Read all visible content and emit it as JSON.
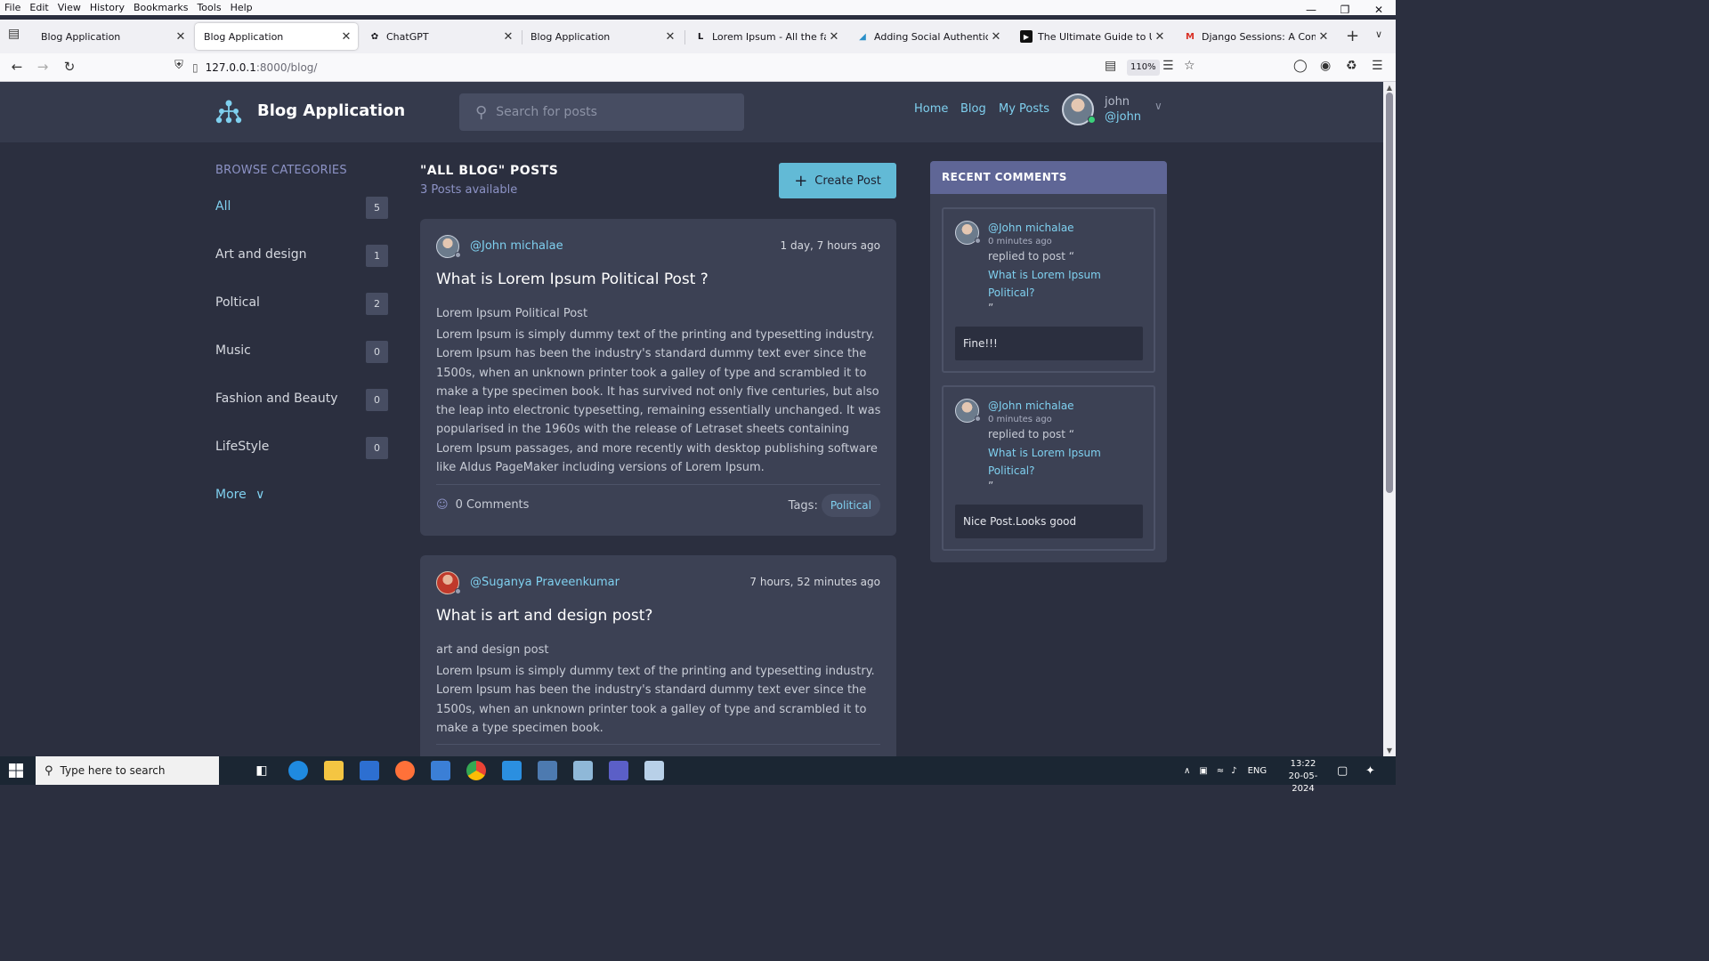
{
  "browser": {
    "menu": [
      "File",
      "Edit",
      "View",
      "History",
      "Bookmarks",
      "Tools",
      "Help"
    ],
    "tabs": [
      {
        "title": "Blog Application",
        "icon": "page-icon"
      },
      {
        "title": "Blog Application",
        "icon": "page-icon"
      },
      {
        "title": "ChatGPT",
        "icon": "chatgpt-icon"
      },
      {
        "title": "Blog Application",
        "icon": "page-icon"
      },
      {
        "title": "Lorem Ipsum - All the facts - Lip",
        "icon": "lipsum-icon"
      },
      {
        "title": "Adding Social Authentication to",
        "icon": "book-icon"
      },
      {
        "title": "The Ultimate Guide to Using Soc",
        "icon": "video-icon"
      },
      {
        "title": "Django Sessions: A Comprehen",
        "icon": "gmail-icon"
      }
    ],
    "url_host": "127.0.0.1",
    "url_path": ":8000/blog/",
    "zoom": "110%"
  },
  "header": {
    "brand": "Blog Application",
    "search_placeholder": "Search for posts",
    "nav": [
      "Home",
      "Blog",
      "My Posts"
    ],
    "user_name": "john",
    "user_handle": "@john"
  },
  "sidebar": {
    "title": "BROWSE CATEGORIES",
    "categories": [
      {
        "label": "All",
        "count": "5"
      },
      {
        "label": "Art and design",
        "count": "1"
      },
      {
        "label": "Poltical",
        "count": "2"
      },
      {
        "label": "Music",
        "count": "0"
      },
      {
        "label": "Fashion and Beauty",
        "count": "0"
      },
      {
        "label": "LifeStyle",
        "count": "0"
      }
    ],
    "more": "More"
  },
  "main": {
    "heading": "\"ALL BLOG\" POSTS",
    "subheading": "3 Posts available",
    "create_label": "Create Post",
    "posts": [
      {
        "author": "@John michalae",
        "time": "1 day, 7 hours ago",
        "title": "What is Lorem Ipsum Political Post ?",
        "subtitle": "Lorem Ipsum Political Post",
        "body": "Lorem Ipsum is simply dummy text of the printing and typesetting industry. Lorem Ipsum has been the industry's standard dummy text ever since the 1500s, when an unknown printer took a galley of type and scrambled it to make a type specimen book. It has survived not only five centuries, but also the leap into electronic typesetting, remaining essentially unchanged. It was popularised in the 1960s with the release of Letraset sheets containing Lorem Ipsum passages, and more recently with desktop publishing software like Aldus PageMaker including versions of Lorem Ipsum.",
        "comments": "0 Comments",
        "tags_label": "Tags:",
        "tag": "Political"
      },
      {
        "author": "@Suganya Praveenkumar",
        "time": "7 hours, 52 minutes ago",
        "title": "What is art and design post?",
        "subtitle": "art and design post",
        "body": "Lorem Ipsum is simply dummy text of the printing and typesetting industry. Lorem Ipsum has been the industry's standard dummy text ever since the 1500s, when an unknown printer took a galley of type and scrambled it to make a type specimen book."
      }
    ]
  },
  "recent_comments": {
    "title": "RECENT COMMENTS",
    "items": [
      {
        "author": "@John michalae",
        "time": "0 minutes ago",
        "replied": "replied to post “",
        "post": "What is Lorem Ipsum Political?",
        "close_quote": "”",
        "text": "Fine!!!"
      },
      {
        "author": "@John michalae",
        "time": "0 minutes ago",
        "replied": "replied to post “",
        "post": "What is Lorem Ipsum Political?",
        "close_quote": "”",
        "text": "Nice Post.Looks good"
      }
    ]
  },
  "taskbar": {
    "search_placeholder": "Type here to search",
    "language": "ENG",
    "time": "13:22",
    "date": "20-05-2024"
  },
  "colors": {
    "page_bg": "#2b2f3f",
    "card_bg": "#3c4154",
    "accent": "#7fd0ef",
    "button": "#62bad6",
    "comments_header": "#5f6696"
  }
}
